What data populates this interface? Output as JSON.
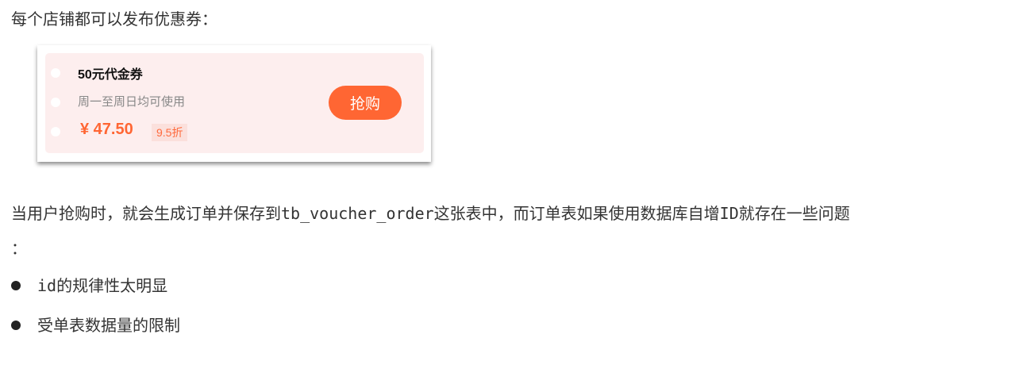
{
  "intro_text": "每个店铺都可以发布优惠券：",
  "voucher": {
    "title": "50元代金券",
    "description": "周一至周日均可使用",
    "price": "¥ 47.50",
    "discount": "9.5折",
    "buy_label": "抢购",
    "accent_color": "#ff6633",
    "background_color": "#fdeeee"
  },
  "paragraph": {
    "line1": "当用户抢购时，就会生成订单并保存到tb_voucher_order这张表中，而订单表如果使用数据库自增ID就存在一些问题",
    "line2": "："
  },
  "bullets": [
    "id的规律性太明显",
    "受单表数据量的限制"
  ]
}
